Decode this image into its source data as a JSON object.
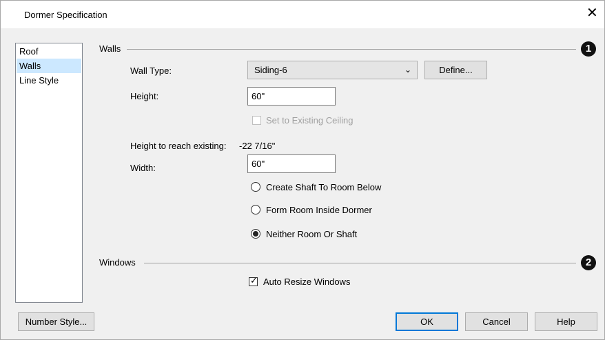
{
  "window": {
    "title": "Dormer Specification",
    "close_glyph": "✕"
  },
  "nav": {
    "items": [
      {
        "label": "Roof"
      },
      {
        "label": "Walls"
      },
      {
        "label": "Line Style"
      }
    ],
    "selected": "Walls"
  },
  "walls": {
    "group_label": "Walls",
    "callout": "1",
    "wall_type_label": "Wall Type:",
    "wall_type_value": "Siding-6",
    "define_button": "Define...",
    "height_label": "Height:",
    "height_value": "60\"",
    "set_existing_label": "Set to Existing Ceiling",
    "height_reach_label": "Height to reach existing:",
    "height_reach_value": "-22 7/16\"",
    "width_label": "Width:",
    "width_value": "60\"",
    "radio_shaft": "Create Shaft To Room Below",
    "radio_form_room": "Form Room Inside Dormer",
    "radio_neither": "Neither Room Or Shaft",
    "radio_selected": "Neither Room Or Shaft"
  },
  "windows": {
    "group_label": "Windows",
    "callout": "2",
    "auto_resize_label": "Auto Resize Windows",
    "auto_resize_checked": true
  },
  "footer": {
    "number_style": "Number Style...",
    "ok": "OK",
    "cancel": "Cancel",
    "help": "Help"
  },
  "colors": {
    "accent": "#0078d7",
    "selection": "#cce8ff"
  }
}
